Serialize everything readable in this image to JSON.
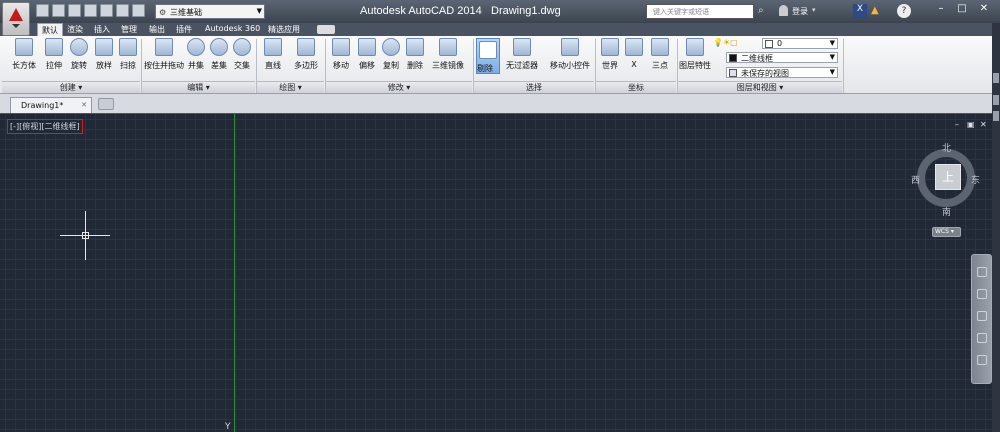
{
  "title": {
    "app": "Autodesk AutoCAD 2014",
    "document": "Drawing1.dwg",
    "workspace": "三维基础",
    "search_placeholder": "键入关键字或短语",
    "login": "登录"
  },
  "tabs": [
    "默认",
    "渲染",
    "插入",
    "管理",
    "输出",
    "插件",
    "Autodesk 360",
    "精选应用"
  ],
  "ribbon": {
    "create": [
      "长方体",
      "拉伸",
      "旋转",
      "放样",
      "扫掠"
    ],
    "create_label": "创建 ▾",
    "edit": [
      "按住并拖动",
      "并集",
      "差集",
      "交集"
    ],
    "edit_label": "编辑 ▾",
    "draw": [
      "直线",
      "多边形"
    ],
    "draw_label": "绘图 ▾",
    "modify": [
      "移动",
      "偏移",
      "复制",
      "删除",
      "三维镜像"
    ],
    "modify_label": "修改 ▾",
    "select": [
      "剔除",
      "无过滤器",
      "移动小控件"
    ],
    "select_label": "选择",
    "coords": [
      "世界",
      "X",
      "三点"
    ],
    "coords_label": "坐标",
    "layers": {
      "props": "图层特性",
      "layer_value": "0",
      "visual_style": "二维线框",
      "view": "未保存的视图"
    },
    "layers_label": "图层和视图 ▾"
  },
  "file_tab": "Drawing1*",
  "viewport": {
    "label": "[-][俯视][二维线框]",
    "viewcube": {
      "face": "上",
      "n": "北",
      "s": "南",
      "e": "东",
      "w": "西"
    },
    "wcs": "WCS ▾",
    "ucs_y": "Y"
  }
}
